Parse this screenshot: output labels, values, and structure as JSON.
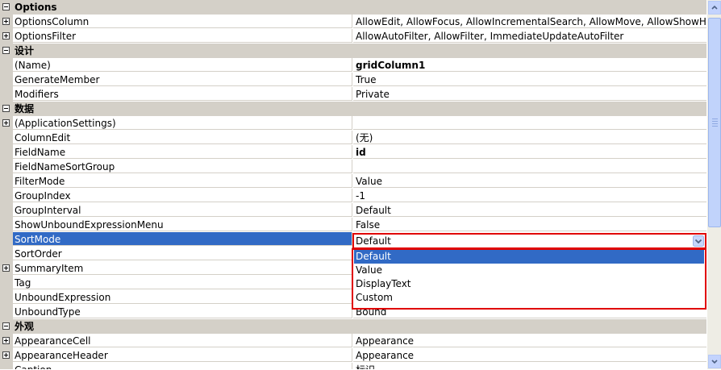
{
  "rows": [
    {
      "type": "cat",
      "label": "Options",
      "expanded": true
    },
    {
      "type": "prop",
      "name": "OptionsColumn",
      "value": "AllowEdit, AllowFocus, AllowIncrementalSearch, AllowMove, AllowShowHide, Allo",
      "expander": "plus"
    },
    {
      "type": "prop",
      "name": "OptionsFilter",
      "value": "AllowAutoFilter, AllowFilter, ImmediateUpdateAutoFilter",
      "expander": "plus"
    },
    {
      "type": "cat",
      "label": "设计",
      "expanded": true
    },
    {
      "type": "prop",
      "name": "(Name)",
      "value": "gridColumn1",
      "bold": true
    },
    {
      "type": "prop",
      "name": "GenerateMember",
      "value": "True"
    },
    {
      "type": "prop",
      "name": "Modifiers",
      "value": "Private"
    },
    {
      "type": "cat",
      "label": "数据",
      "expanded": true
    },
    {
      "type": "prop",
      "name": "(ApplicationSettings)",
      "value": "",
      "expander": "plus"
    },
    {
      "type": "prop",
      "name": "ColumnEdit",
      "value": "(无)"
    },
    {
      "type": "prop",
      "name": "FieldName",
      "value": "id",
      "bold": true
    },
    {
      "type": "prop",
      "name": "FieldNameSortGroup",
      "value": ""
    },
    {
      "type": "prop",
      "name": "FilterMode",
      "value": "Value"
    },
    {
      "type": "prop",
      "name": "GroupIndex",
      "value": "-1"
    },
    {
      "type": "prop",
      "name": "GroupInterval",
      "value": "Default"
    },
    {
      "type": "prop",
      "name": "ShowUnboundExpressionMenu",
      "value": "False"
    },
    {
      "type": "prop",
      "name": "SortMode",
      "value": "",
      "selected": true
    },
    {
      "type": "prop",
      "name": "SortOrder",
      "value": ""
    },
    {
      "type": "prop",
      "name": "SummaryItem",
      "value": "",
      "expander": "plus"
    },
    {
      "type": "prop",
      "name": "Tag",
      "value": ""
    },
    {
      "type": "prop",
      "name": "UnboundExpression",
      "value": ""
    },
    {
      "type": "prop",
      "name": "UnboundType",
      "value": "Bound"
    },
    {
      "type": "cat",
      "label": "外观",
      "expanded": true
    },
    {
      "type": "prop",
      "name": "AppearanceCell",
      "value": "Appearance",
      "expander": "plus"
    },
    {
      "type": "prop",
      "name": "AppearanceHeader",
      "value": "Appearance",
      "expander": "plus"
    },
    {
      "type": "prop",
      "name": "Caption",
      "value": "标识"
    }
  ],
  "sortmode_combo": {
    "current": "Default",
    "options": [
      "Default",
      "Value",
      "DisplayText",
      "Custom"
    ],
    "selected_index": 0
  },
  "colors": {
    "category_bg": "#d4d0c8",
    "selection": "#316ac5",
    "highlight_border": "#e00000"
  }
}
